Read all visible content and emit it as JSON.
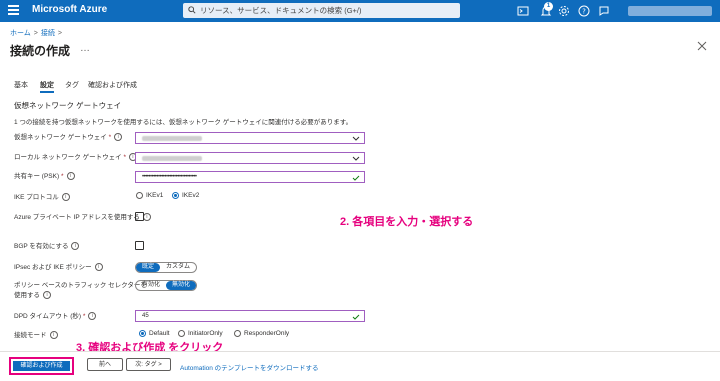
{
  "app": {
    "brand": "Microsoft Azure"
  },
  "search": {
    "placeholder": "リソース、サービス、ドキュメントの検索 (G+/)"
  },
  "topbar": {
    "notification_count": "1"
  },
  "breadcrumb": {
    "home": "ホーム",
    "separator": ">",
    "current": "接続",
    "tail": ">"
  },
  "page": {
    "title": "接続の作成",
    "more": "…"
  },
  "tabs": [
    {
      "label": "基本",
      "active": false
    },
    {
      "label": "設定",
      "active": true
    },
    {
      "label": "タグ",
      "active": false
    },
    {
      "label": "確認および作成",
      "active": false
    }
  ],
  "section": {
    "title": "仮想ネットワーク ゲートウェイ",
    "description": "1 つの接続を持つ仮想ネットワークを使用するには、仮想ネットワーク ゲートウェイに関連付ける必要があります。"
  },
  "fields": {
    "vnet_gateway": {
      "label": "仮想ネットワーク ゲートウェイ",
      "required": "*"
    },
    "local_gateway": {
      "label": "ローカル ネットワーク ゲートウェイ",
      "required": "*"
    },
    "psk": {
      "label": "共有キー (PSK)",
      "required": "*",
      "value": "••••••••••••••••••••••••••••••••••"
    },
    "ike": {
      "label": "IKE プロトコル",
      "options": [
        "IKEv1",
        "IKEv2"
      ],
      "selected": "IKEv2"
    },
    "private_ip": {
      "label": "Azure プライベート IP アドレスを使用する",
      "checked": false
    },
    "bgp": {
      "label": "BGP を有効にする",
      "checked": false
    },
    "ipsec": {
      "label": "IPsec および IKE ポリシー",
      "options": [
        "既定",
        "カスタム"
      ],
      "selected": "既定"
    },
    "policy_selector": {
      "label_line1": "ポリシー ベースのトラフィック セレクターを",
      "label_line2": "使用する",
      "options": [
        "有効化",
        "無効化"
      ],
      "selected": "無効化"
    },
    "dpd": {
      "label": "DPD タイムアウト (秒)",
      "required": "*",
      "value": "45"
    },
    "conn_mode": {
      "label": "接続モード",
      "options": [
        "Default",
        "InitiatorOnly",
        "ResponderOnly"
      ],
      "selected": "Default"
    }
  },
  "annotations": {
    "step2": "2. 各項目を入力・選択する",
    "step3": "3. 確認および作成 をクリック"
  },
  "footer": {
    "review_create": "確認および作成",
    "prev": "前へ",
    "next": "次: タグ >",
    "automation_link": "Automation のテンプレートをダウンロードする"
  },
  "colors": {
    "accent": "#0f6cbd",
    "annotation": "#e6007e",
    "field_border": "#a05ec0",
    "valid_check": "#107c10"
  }
}
